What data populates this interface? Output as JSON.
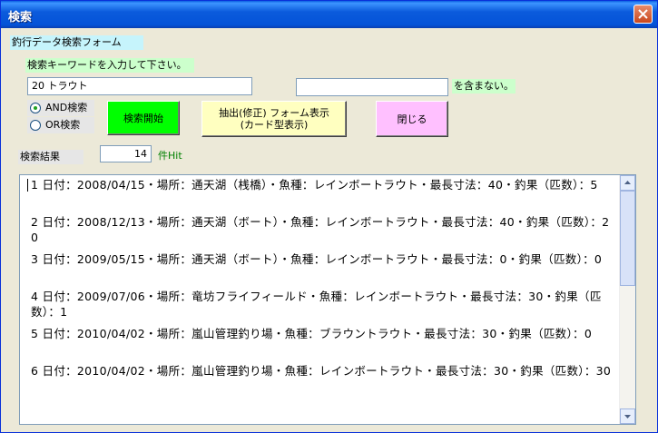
{
  "window": {
    "title": "検索"
  },
  "form": {
    "heading": "釣行データ検索フォーム",
    "keyword_prompt": "検索キーワードを入力して下さい。",
    "keyword_value": "20 トラウト",
    "exclude_value": "",
    "exclude_suffix": "を含まない。",
    "and_label": "AND検索",
    "or_label": "OR検索",
    "search_mode": "AND",
    "search_button": "検索開始",
    "extract_button_line1": "抽出(修正) フォーム表示",
    "extract_button_line2": "(カード型表示)",
    "close_button": "閉じる",
    "result_label": "検索結果",
    "hit_count": "14",
    "hit_suffix": "件Hit"
  },
  "results": [
    "1 日付：2008/04/15・場所：通天湖（桟橋）・魚種：レインボートラウト・最長寸法：40・釣果（匹数）：5",
    "2 日付：2008/12/13・場所：通天湖（ボート）・魚種：レインボートラウト・最長寸法：40・釣果（匹数）：20",
    "3 日付：2009/05/15・場所：通天湖（ボート）・魚種：レインボートラウト・最長寸法：0・釣果（匹数）：0",
    "4 日付：2009/07/06・場所：竜坊フライフィールド・魚種：レインボートラウト・最長寸法：30・釣果（匹数）：1",
    "5 日付：2010/04/02・場所：嵐山管理釣り場・魚種：ブラウントラウト・最長寸法：30・釣果（匹数）：0",
    "6 日付：2010/04/02・場所：嵐山管理釣り場・魚種：レインボートラウト・最長寸法：30・釣果（匹数）：30"
  ],
  "colors": {
    "heading_bg": "#c6f4fc",
    "prompt_bg": "#ccffcc",
    "search_button_bg": "#00ff00",
    "extract_button_bg": "#ffffc0",
    "close_button_bg": "#ffc0ff",
    "hit_text": "#008000"
  }
}
